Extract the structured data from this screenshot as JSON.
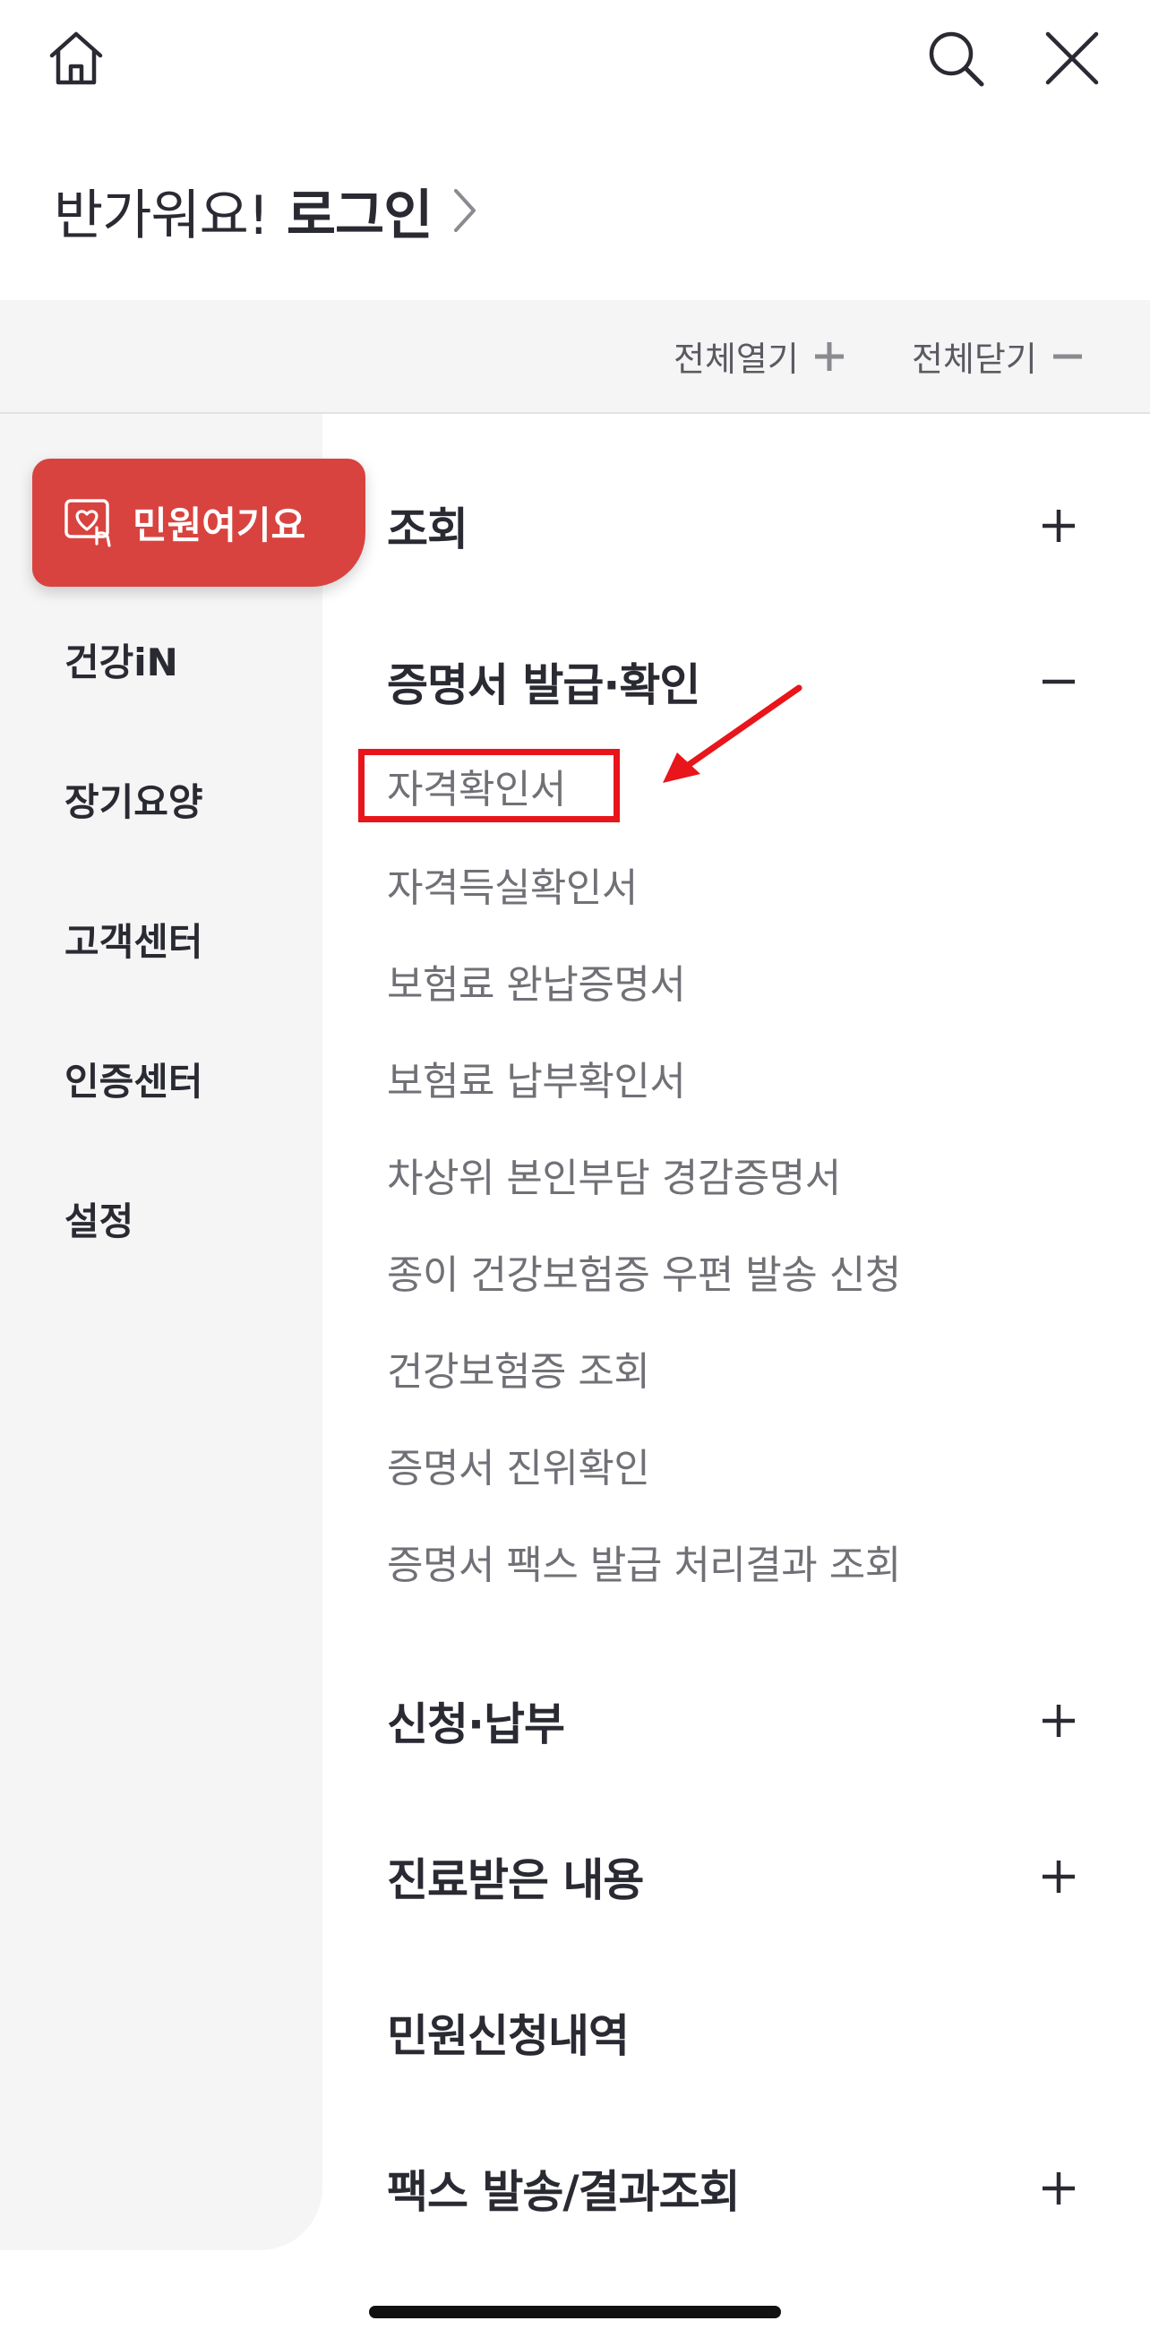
{
  "greeting": {
    "hello": "반가워요!",
    "login": "로그인"
  },
  "toolbar": {
    "open_all": "전체열기",
    "close_all": "전체닫기"
  },
  "sidebar": {
    "active": "민원여기요",
    "items": [
      "건강iN",
      "장기요양",
      "고객센터",
      "인증센터",
      "설정"
    ]
  },
  "menu": {
    "sections": [
      {
        "title": "조회",
        "state": "+"
      },
      {
        "title": "증명서 발급·확인",
        "state": "−"
      },
      {
        "title": "신청·납부",
        "state": "+"
      },
      {
        "title": "진료받은 내용",
        "state": "+"
      },
      {
        "title": "민원신청내역",
        "state": ""
      },
      {
        "title": "팩스 발송/결과조회",
        "state": "+"
      }
    ],
    "certificate_items": [
      "자격확인서",
      "자격득실확인서",
      "보험료 완납증명서",
      "보험료 납부확인서",
      "차상위 본인부담 경감증명서",
      "종이 건강보험증 우편 발송 신청",
      "건강보험증 조회",
      "증명서 진위확인",
      "증명서 팩스 발급 처리결과 조회"
    ]
  },
  "icons": {
    "home": "home-icon",
    "search": "search-icon",
    "close": "close-icon",
    "chevron": "chevron-right-icon",
    "active_menu": "heart-hand-icon",
    "plus": "plus-icon",
    "minus": "minus-icon"
  },
  "colors": {
    "accent": "#d9433f",
    "annotation": "#e8151b",
    "sidebar_bg": "#f5f5f5",
    "text_dark": "#2a2a33",
    "text_muted": "#707076"
  }
}
